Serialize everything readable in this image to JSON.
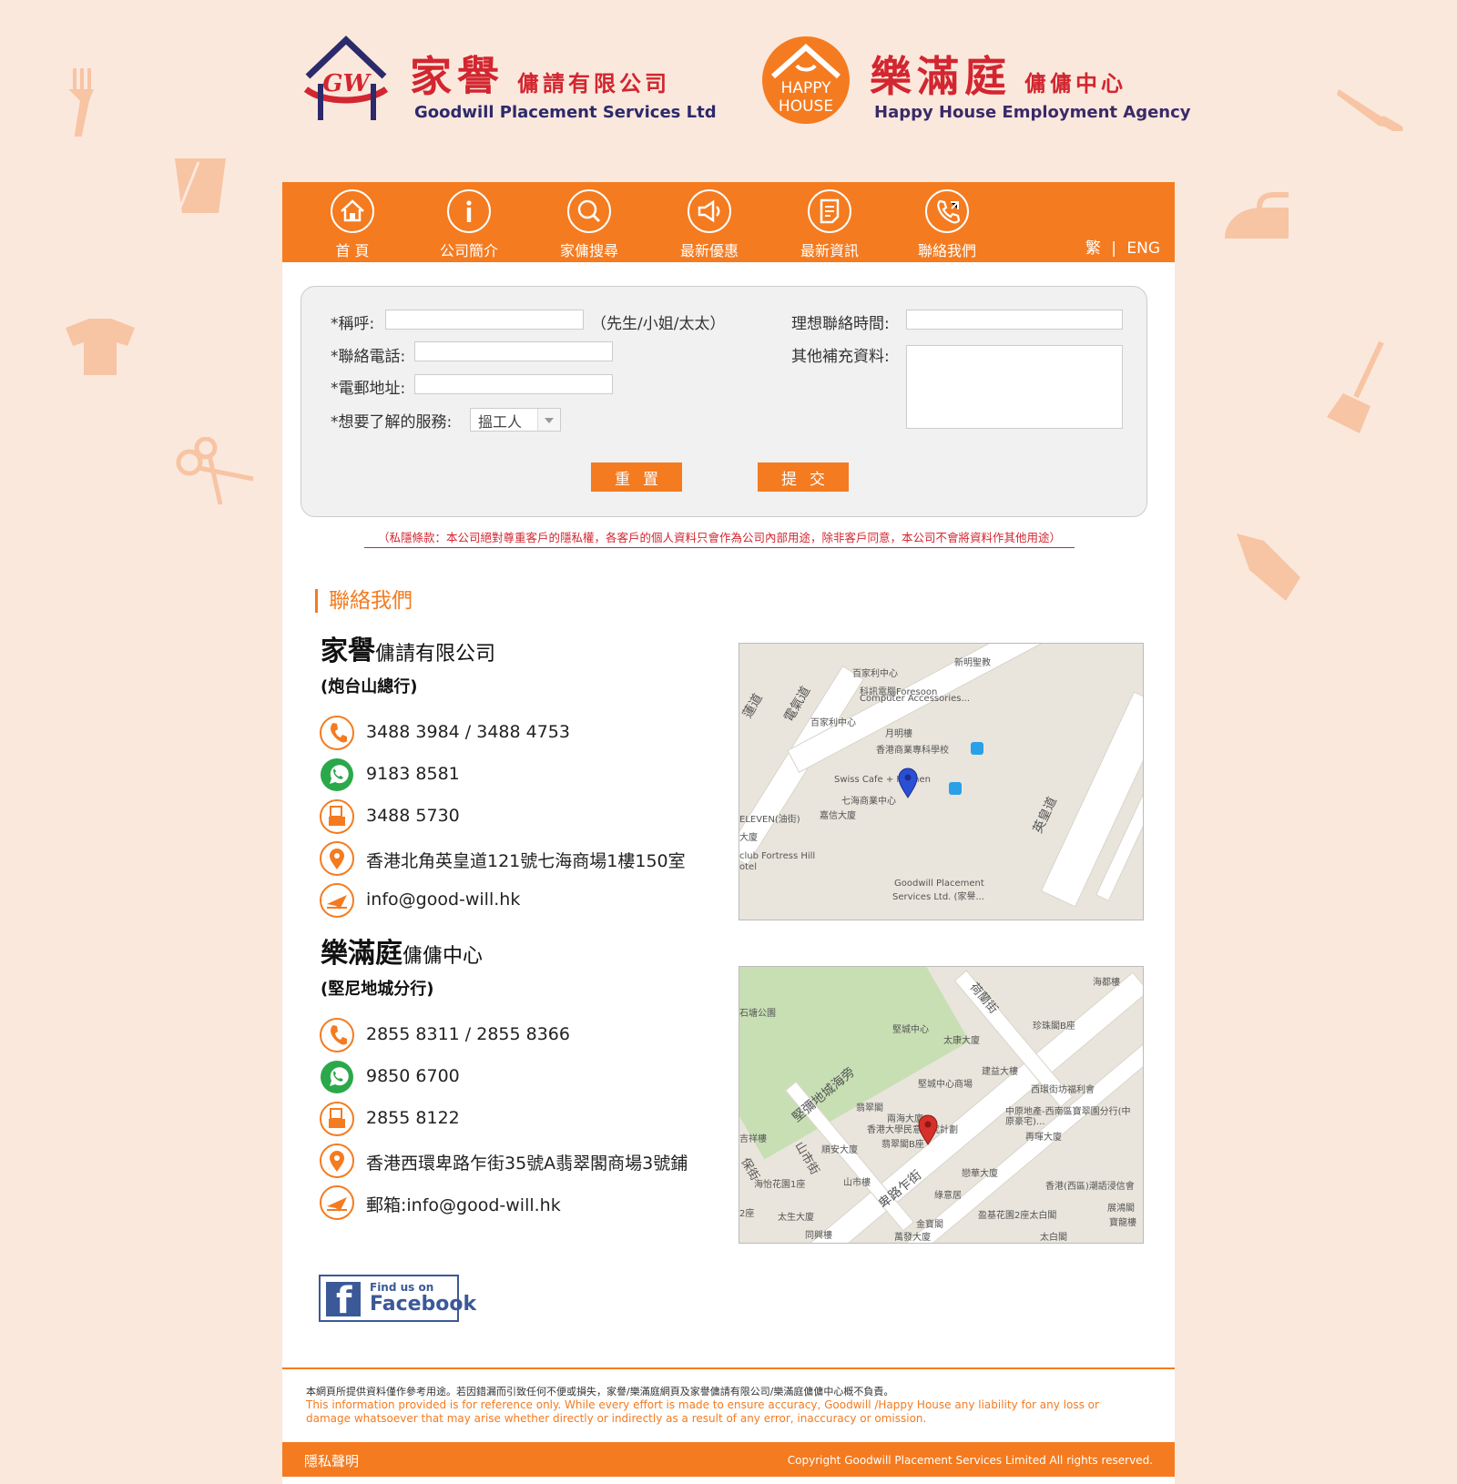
{
  "brands": {
    "goodwill": {
      "mark": "GW",
      "cn_name": "家譽",
      "cn_suffix": "傭請有限公司",
      "en_name": "Goodwill Placement Services Ltd"
    },
    "happy_house": {
      "mark_line1": "HAPPY",
      "mark_line2": "HOUSE",
      "cn_name": "樂滿庭",
      "cn_suffix": "傭傭中心",
      "en_name": "Happy House Employment Agency"
    }
  },
  "nav": {
    "items": [
      {
        "label": "首 頁",
        "icon": "home-icon"
      },
      {
        "label": "公司簡介",
        "icon": "info-icon"
      },
      {
        "label": "家傭搜尋",
        "icon": "search-icon"
      },
      {
        "label": "最新優惠",
        "icon": "megaphone-icon"
      },
      {
        "label": "最新資訊",
        "icon": "news-icon"
      },
      {
        "label": "聯絡我們",
        "icon": "phone-icon"
      }
    ],
    "lang_zh": "繁",
    "lang_sep": "|",
    "lang_en": "ENG"
  },
  "form": {
    "salutation_label": "*稱呼:",
    "salutation_hint": "（先生/小姐/太太）",
    "phone_label": "*聯絡電話:",
    "email_label": "*電郵地址:",
    "service_label": "*想要了解的服務:",
    "service_selected": "搵工人",
    "contact_time_label": "理想聯絡時間:",
    "extra_label": "其他補充資料:",
    "reset_label": "重置",
    "submit_label": "提交"
  },
  "privacy_note": "（私隱條款：本公司絕對尊重客戶的隱私權，各客戶的個人資料只會作為公司內部用途，除非客戶同意，本公司不會將資料作其他用途）",
  "contact": {
    "section_title": "聯絡我們",
    "companies": [
      {
        "name": "家譽",
        "suffix": "傭請有限公司",
        "branch": "(炮台山總行)",
        "phone": "3488 3984 / 3488 4753",
        "whatsapp": "9183 8581",
        "fax": "3488 5730",
        "address": "香港北角英皇道121號七海商場1樓150室",
        "email": "info@good-will.hk",
        "map_labels": [
          "百家利中心",
          "新明聖教",
          "科訊電腦Foresoon",
          "Computer Accessories...",
          "百家利中心",
          "月明樓",
          "香港商業專科學校",
          "Swiss Cafe + Kitchen",
          "七海商業中心",
          "嘉信大廈",
          "ELEVEN(油街)",
          "大廈",
          "club Fortress Hill",
          "otel",
          "Goodwill Placement",
          "Services Ltd. (家譽...",
          "電氣道",
          "英皇道",
          "蓮道"
        ]
      },
      {
        "name": "樂滿庭",
        "suffix": "傭傭中心",
        "branch": "(堅尼地城分行)",
        "phone": "2855 8311 / 2855 8366",
        "whatsapp": "9850 6700",
        "fax": "2855 8122",
        "address": "香港西環卑路乍街35號A翡翠閣商場3號鋪",
        "email": "郵箱:info@good-will.hk",
        "map_labels": [
          "海都樓",
          "荷蘭街",
          "珍珠閣B座",
          "石塘公園",
          "堅城中心",
          "太康大廈",
          "建益大樓",
          "西環街坊福利會",
          "堅城中心商場",
          "堅彌地城海旁",
          "翡翠閣",
          "兩海大廈",
          "香港大學民意研究計劃",
          "翡翠閣B座",
          "中原地產-西南區寶翠園分行(中原豪宅)...",
          "再暉大廈",
          "順安大廈",
          "山市街",
          "戀華大廈",
          "香港(西區)潮語浸信會",
          "卑路乍街",
          "海怡花園1座",
          "山市樓",
          "綠意居",
          "展鴻閣",
          "太生大廈",
          "盈基花園2座太白閣",
          "寶龍樓",
          "同興樓",
          "金寶閣",
          "萬發大廈",
          "太白閣",
          "吉祥樓",
          "保街",
          "2座"
        ]
      }
    ]
  },
  "facebook": {
    "find": "Find us on",
    "name": "Facebook"
  },
  "disclaimer": {
    "cn": "本網頁所提供資料僅作參考用途。若因錯漏而引致任何不便或損失，家譽/樂滿庭網頁及家譽傭請有限公司/樂滿庭傭傭中心概不負責。",
    "en": "This information provided is for reference only. While every effort is made to ensure accuracy, Goodwill /Happy House any liability for any loss or damage whatsoever that may arise whether directly or indirectly as a result of any error, inaccuracy or omission."
  },
  "footer": {
    "privacy_link": "隱私聲明",
    "copyright": "Copyright Goodwill Placement Services Limited All rights reserved."
  },
  "colors": {
    "accent": "#f47b20",
    "brand_red": "#d22630",
    "brand_navy": "#2c2a6b",
    "page_bg": "#fbe8dc",
    "facebook": "#3b5998"
  }
}
